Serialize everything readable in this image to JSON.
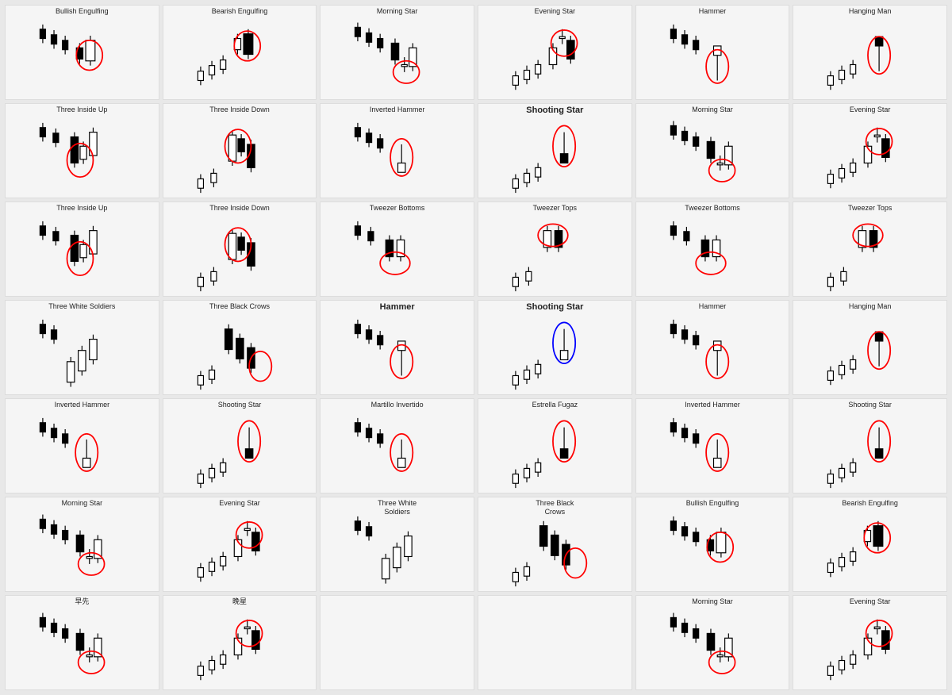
{
  "cards": [
    {
      "id": "bullish-engulfing",
      "title": "Bullish Engulfing",
      "bold": false,
      "type": "bullish-engulfing"
    },
    {
      "id": "bearish-engulfing",
      "title": "Bearish Engulfing",
      "bold": false,
      "type": "bearish-engulfing"
    },
    {
      "id": "morning-star-1",
      "title": "Morning Star",
      "bold": false,
      "type": "morning-star"
    },
    {
      "id": "evening-star-1",
      "title": "Evening Star",
      "bold": false,
      "type": "evening-star"
    },
    {
      "id": "hammer-1",
      "title": "Hammer",
      "bold": false,
      "type": "hammer"
    },
    {
      "id": "hanging-man-1",
      "title": "Hanging Man",
      "bold": false,
      "type": "hanging-man"
    },
    {
      "id": "three-inside-up-1",
      "title": "Three Inside Up",
      "bold": false,
      "type": "three-inside-up"
    },
    {
      "id": "three-inside-down-1",
      "title": "Three Inside Down",
      "bold": false,
      "type": "three-inside-down"
    },
    {
      "id": "inverted-hammer-1",
      "title": "Inverted Hammer",
      "bold": false,
      "type": "inverted-hammer"
    },
    {
      "id": "shooting-star-1",
      "title": "Shooting Star",
      "bold": true,
      "type": "shooting-star"
    },
    {
      "id": "morning-star-2",
      "title": "Morning Star",
      "bold": false,
      "type": "morning-star"
    },
    {
      "id": "evening-star-2",
      "title": "Evening Star",
      "bold": false,
      "type": "evening-star"
    },
    {
      "id": "three-inside-up-2",
      "title": "Three Inside Up",
      "bold": false,
      "type": "three-inside-up"
    },
    {
      "id": "three-inside-down-2",
      "title": "Three Inside Down",
      "bold": false,
      "type": "three-inside-down"
    },
    {
      "id": "tweezer-bottoms-1",
      "title": "Tweezer Bottoms",
      "bold": false,
      "type": "tweezer-bottoms"
    },
    {
      "id": "tweezer-tops-1",
      "title": "Tweezer Tops",
      "bold": false,
      "type": "tweezer-tops"
    },
    {
      "id": "tweezer-bottoms-2",
      "title": "Tweezer Bottoms",
      "bold": false,
      "type": "tweezer-bottoms"
    },
    {
      "id": "tweezer-tops-2",
      "title": "Tweezer Tops",
      "bold": false,
      "type": "tweezer-tops"
    },
    {
      "id": "three-white-soldiers-1",
      "title": "Three White Soldiers",
      "bold": false,
      "type": "three-white-soldiers"
    },
    {
      "id": "three-black-crows-1",
      "title": "Three Black Crows",
      "bold": false,
      "type": "three-black-crows"
    },
    {
      "id": "hammer-2",
      "title": "Hammer",
      "bold": true,
      "type": "hammer"
    },
    {
      "id": "shooting-star-2",
      "title": "Shooting Star",
      "bold": true,
      "type": "shooting-star-blue"
    },
    {
      "id": "hammer-3",
      "title": "Hammer",
      "bold": false,
      "type": "hammer"
    },
    {
      "id": "hanging-man-2",
      "title": "Hanging Man",
      "bold": false,
      "type": "hanging-man"
    },
    {
      "id": "inverted-hammer-2",
      "title": "Inverted Hammer",
      "bold": false,
      "type": "inverted-hammer"
    },
    {
      "id": "shooting-star-3",
      "title": "Shooting Star",
      "bold": false,
      "type": "shooting-star"
    },
    {
      "id": "martillo-invertido",
      "title": "Martillo Invertido",
      "bold": false,
      "type": "inverted-hammer"
    },
    {
      "id": "estrella-fugaz",
      "title": "Estrella Fugaz",
      "bold": false,
      "type": "shooting-star"
    },
    {
      "id": "inverted-hammer-3",
      "title": "Inverted Hammer",
      "bold": false,
      "type": "inverted-hammer"
    },
    {
      "id": "shooting-star-4",
      "title": "Shooting Star",
      "bold": false,
      "type": "shooting-star"
    },
    {
      "id": "morning-star-3",
      "title": "Morning Star",
      "bold": false,
      "type": "morning-star"
    },
    {
      "id": "evening-star-3",
      "title": "Evening Star",
      "bold": false,
      "type": "evening-star"
    },
    {
      "id": "three-white-soldiers-2",
      "title": "Three White\nSoldiers",
      "bold": false,
      "type": "three-white-soldiers"
    },
    {
      "id": "three-black-crows-2",
      "title": "Three Black\nCrows",
      "bold": false,
      "type": "three-black-crows"
    },
    {
      "id": "bullish-engulfing-2",
      "title": "Bullish Engulfing",
      "bold": false,
      "type": "bullish-engulfing"
    },
    {
      "id": "bearish-engulfing-2",
      "title": "Bearish Engulfing",
      "bold": false,
      "type": "bearish-engulfing"
    },
    {
      "id": "morning-star-cn",
      "title": "早先",
      "bold": false,
      "type": "morning-star"
    },
    {
      "id": "evening-star-cn",
      "title": "晚星",
      "bold": false,
      "type": "evening-star"
    },
    {
      "id": "empty1",
      "title": "",
      "bold": false,
      "type": "empty"
    },
    {
      "id": "empty2",
      "title": "",
      "bold": false,
      "type": "empty"
    },
    {
      "id": "morning-star-4",
      "title": "Morning Star",
      "bold": false,
      "type": "morning-star"
    },
    {
      "id": "evening-star-4",
      "title": "Evening Star",
      "bold": false,
      "type": "evening-star"
    }
  ]
}
